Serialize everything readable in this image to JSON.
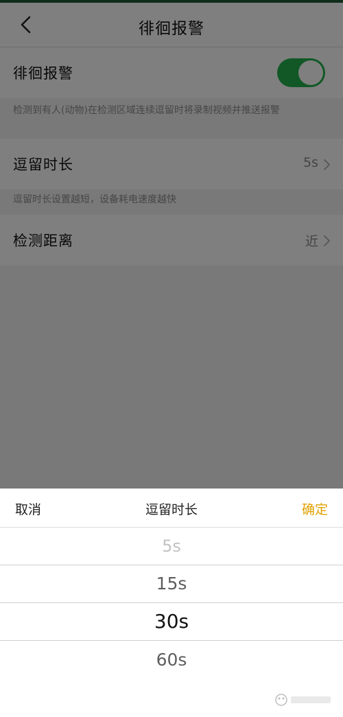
{
  "nav": {
    "title": "徘徊报警",
    "back_icon": "chevron-left-icon"
  },
  "settings": {
    "loiter_alarm": {
      "label": "徘徊报警",
      "enabled": true,
      "note": "检测到有人(动物)在检测区域连续逗留时将录制视频并推送报警"
    },
    "stay_duration": {
      "label": "逗留时长",
      "value": "5s",
      "note": "逗留时长设置越短，设备耗电速度越快"
    },
    "detect_distance": {
      "label": "检测距离",
      "value": "近"
    }
  },
  "picker": {
    "cancel_label": "取消",
    "title": "逗留时长",
    "confirm_label": "确定",
    "options": [
      "5s",
      "15s",
      "30s",
      "60s"
    ],
    "selected": "30s"
  },
  "colors": {
    "toggle_on": "#23b14d",
    "confirm": "#e0a100",
    "header_strip": "#1f5a36"
  }
}
